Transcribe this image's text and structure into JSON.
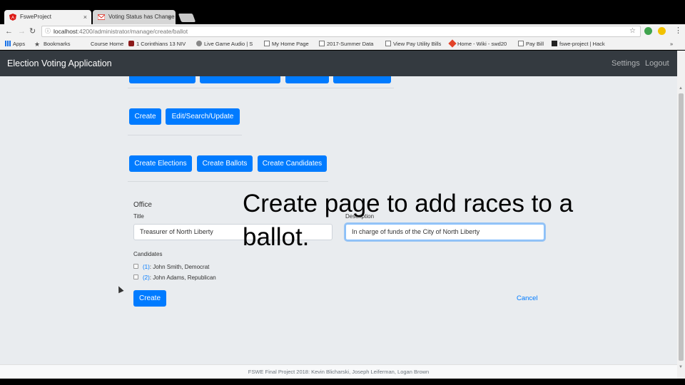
{
  "browser": {
    "tabs": [
      {
        "label": "FsweProject",
        "icon": "angular-icon",
        "active": true
      },
      {
        "label": "Voting Status has Change",
        "icon": "gmail-icon",
        "active": false
      }
    ],
    "close_glyph": "×",
    "url_host": "localhost",
    "url_rest": ":4200/administrator/manage/create/ballot",
    "bookmarks": [
      {
        "label": "Apps",
        "icon": "apps-grid-icon"
      },
      {
        "label": "Bookmarks",
        "icon": "star-icon"
      },
      {
        "label": "Course Home",
        "icon": "blank-icon"
      },
      {
        "label": "1 Corinthians 13 NIV",
        "icon": "bible-icon"
      },
      {
        "label": "Live Game Audio | S",
        "icon": "audio-icon"
      },
      {
        "label": "My Home Page",
        "icon": "page-icon"
      },
      {
        "label": "2017-Summer Data",
        "icon": "page-icon"
      },
      {
        "label": "View Pay Utility Bills",
        "icon": "page-icon"
      },
      {
        "label": "Home - Wiki - swd20",
        "icon": "gitlab-icon"
      },
      {
        "label": "Pay Bill",
        "icon": "page-icon"
      },
      {
        "label": "fswe-project | Hack",
        "icon": "hackmd-icon"
      }
    ],
    "overflow_glyph": "»"
  },
  "app": {
    "brand": "Election Voting Application",
    "nav": {
      "settings": "Settings",
      "logout": "Logout"
    },
    "action_buttons": [
      "Create",
      "Edit/Search/Update"
    ],
    "create_buttons": [
      "Create Elections",
      "Create Ballots",
      "Create Candidates"
    ],
    "form": {
      "section_title": "Office",
      "title_label": "Title",
      "title_value": "Treasurer of North Liberty",
      "description_label": "Description",
      "description_value": "In charge of funds of the City of North Liberty",
      "candidates_label": "Candidates",
      "candidates": [
        {
          "number": "(1)",
          "text": ": John Smith, Democrat"
        },
        {
          "number": "(2)",
          "text": ": John Adams, Republican"
        }
      ],
      "create_button": "Create",
      "cancel_link": "Cancel"
    },
    "footer": "FSWE Final Project 2018: Kevin Blicharski, Joseph Leiferman, Logan Brown"
  },
  "caption": "Create page to add races to a ballot.",
  "colors": {
    "primary": "#007bff",
    "navbar": "#343a40",
    "background": "#e9ecef"
  }
}
